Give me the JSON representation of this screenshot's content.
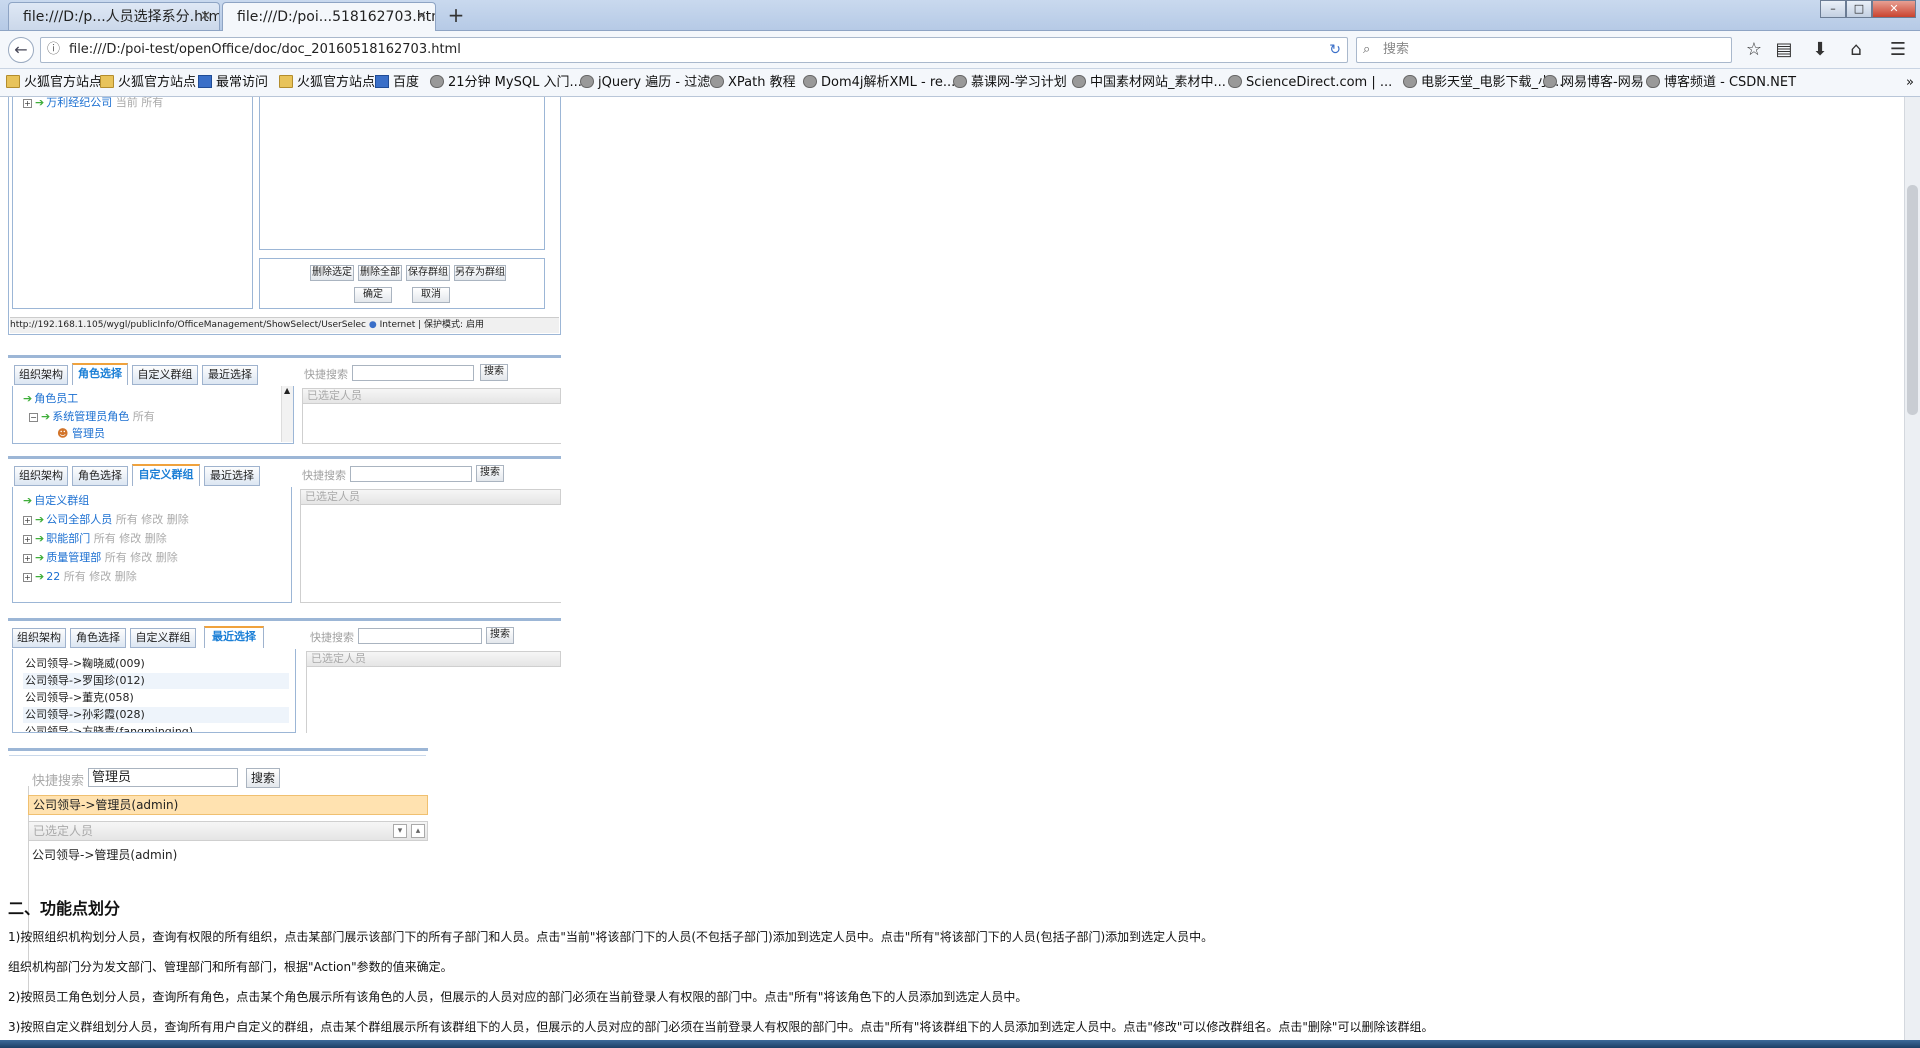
{
  "browser": {
    "tabs": [
      {
        "title": "file:///D:/p...人员选择系分.html",
        "active": false
      },
      {
        "title": "file:///D:/poi...518162703.html",
        "active": true
      }
    ],
    "new_tab": "+",
    "url": "file:///D:/poi-test/openOffice/doc/doc_20160518162703.html",
    "search_placeholder": "搜索",
    "bookmarks": [
      {
        "label": "火狐官方站点",
        "icon": "folder"
      },
      {
        "label": "火狐官方站点",
        "icon": "folder"
      },
      {
        "label": "最常访问",
        "icon": "blue"
      },
      {
        "label": "火狐官方站点",
        "icon": "folder"
      },
      {
        "label": "百度",
        "icon": "blue"
      },
      {
        "label": "21分钟 MySQL 入门...",
        "icon": "globe"
      },
      {
        "label": "jQuery 遍历 - 过滤",
        "icon": "globe"
      },
      {
        "label": "XPath 教程",
        "icon": "globe"
      },
      {
        "label": "Dom4j解析XML - re...",
        "icon": "globe"
      },
      {
        "label": "慕课网-学习计划",
        "icon": "globe"
      },
      {
        "label": "中国素材网站_素材中...",
        "icon": "globe"
      },
      {
        "label": "ScienceDirect.com | ...",
        "icon": "globe"
      },
      {
        "label": "电影天堂_电影下载_小...",
        "icon": "globe"
      },
      {
        "label": "网易博客-网易",
        "icon": "globe"
      },
      {
        "label": "博客频道 - CSDN.NET",
        "icon": "globe"
      }
    ],
    "bookmarks_more": "»"
  },
  "shot1": {
    "top_tree_item": "万利经纪公司",
    "top_tree_suffix": "当前 所有",
    "buttons": [
      "删除选定",
      "删除全部",
      "保存群组",
      "另存为群组"
    ],
    "ok": "确定",
    "cancel": "取消",
    "status_url": "http://192.168.1.105/wygl/publicInfo/OfficeManagement/ShowSelect/UserSelec",
    "status_zone": "Internet | 保护模式: 启用"
  },
  "tabs_labels": [
    "组织架构",
    "角色选择",
    "自定义群组",
    "最近选择"
  ],
  "quick_search": "快捷搜索",
  "search_btn": "搜索",
  "selected_header": "已选定人员",
  "shot2": {
    "root": "角色员工",
    "child": "系统管理员角色",
    "child_suffix": "所有",
    "leaf": "管理员"
  },
  "shot3": {
    "root": "自定义群组",
    "items": [
      {
        "name": "公司全部人员",
        "suffix": "所有 修改 删除"
      },
      {
        "name": "职能部门",
        "suffix": "所有 修改 删除"
      },
      {
        "name": "质量管理部",
        "suffix": "所有 修改 删除"
      },
      {
        "name": "22",
        "suffix": "所有 修改 删除"
      }
    ]
  },
  "shot4": {
    "recent": [
      "公司领导->鞠晓威(009)",
      "公司领导->罗国珍(012)",
      "公司领导->董克(058)",
      "公司领导->孙彩霞(028)",
      "公司领导->方晓青(fangmingjng)"
    ]
  },
  "shot5": {
    "search_value": "管理员",
    "result": "公司领导->管理员(admin)",
    "selected": "公司领导->管理员(admin)"
  },
  "doc": {
    "heading": "二、功能点划分",
    "paragraphs": [
      "1)按照组织机构划分人员，查询有权限的所有组织，点击某部门展示该部门下的所有子部门和人员。点击\"当前\"将该部门下的人员(不包括子部门)添加到选定人员中。点击\"所有\"将该部门下的人员(包括子部门)添加到选定人员中。",
      "组织机构部门分为发文部门、管理部门和所有部门，根据\"Action\"参数的值来确定。",
      "2)按照员工角色划分人员，查询所有角色，点击某个角色展示所有该角色的人员，但展示的人员对应的部门必须在当前登录人有权限的部门中。点击\"所有\"将该角色下的人员添加到选定人员中。",
      "3)按照自定义群组划分人员，查询所有用户自定义的群组，点击某个群组展示所有该群组下的人员，但展示的人员对应的部门必须在当前登录人有权限的部门中。点击\"所有\"将该群组下的人员添加到选定人员中。点击\"修改\"可以修改群组名。点击\"删除\"可以删除该群组。"
    ]
  }
}
